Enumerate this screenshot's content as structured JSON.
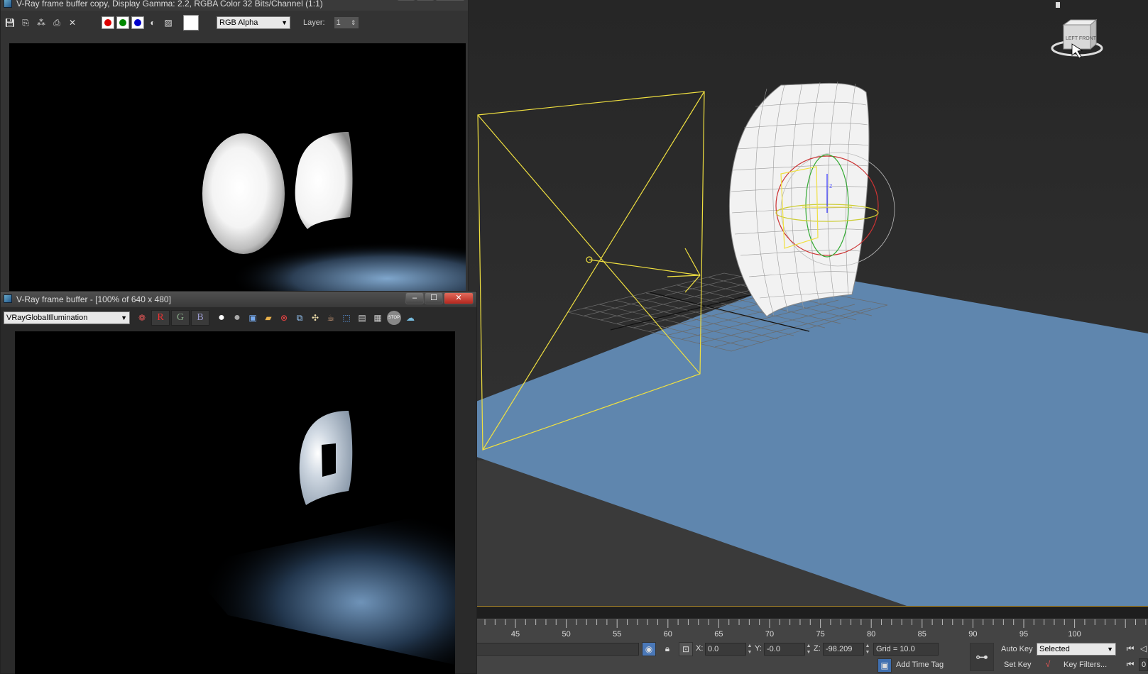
{
  "viewport": {
    "viewcube_label": "LEFT FRONT",
    "gizmo_axis": "z",
    "colors": {
      "background": "#2b2b2b",
      "floor": "#5f86ae",
      "helper": "#f0e040",
      "mesh": "#ffffff"
    }
  },
  "timeline": {
    "ticks": [
      "45",
      "50",
      "55",
      "60",
      "65",
      "70",
      "75",
      "80",
      "85",
      "90",
      "95",
      "100"
    ]
  },
  "status": {
    "x_label": "X:",
    "x_value": "0.0",
    "y_label": "Y:",
    "y_value": "-0.0",
    "z_label": "Z:",
    "z_value": "-98.209",
    "grid": "Grid = 10.0",
    "add_time_tag": "Add Time Tag",
    "auto_key": "Auto Key",
    "set_key": "Set Key",
    "selected_option": "Selected",
    "key_filters": "Key Filters...",
    "frame_field": "0"
  },
  "vfb_copy": {
    "title": "V-Ray frame buffer copy, Display Gamma: 2.2, RGBA Color 32 Bits/Channel (1:1)",
    "channel_select": "RGB Alpha",
    "layer_label": "Layer:",
    "layer_value": "1"
  },
  "vfb": {
    "title": "V-Ray frame buffer - [100% of 640 x 480]",
    "element_select": "VRayGlobalIllumination",
    "r": "R",
    "g": "G",
    "b": "B",
    "stop_label": "STOP",
    "minimize": "‒",
    "maximize": "☐",
    "close": "✕"
  }
}
